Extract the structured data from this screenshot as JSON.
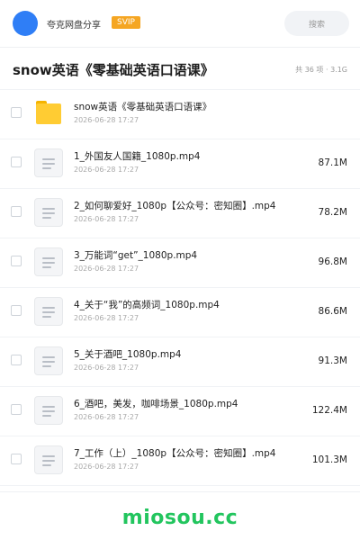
{
  "header": {
    "app_name": "夸克网盘分享",
    "vip_badge": "SVIP",
    "search_placeholder": "搜索"
  },
  "folder": {
    "title": "snow英语《零基础英语口语课》",
    "meta": "共 36 项 · 3.1G"
  },
  "items": [
    {
      "type": "folder",
      "name": "snow英语《零基础英语口语课》",
      "date": "2026-06-28 17:27",
      "size": ""
    },
    {
      "type": "file",
      "name": "1_外国友人国籍_1080p.mp4",
      "date": "2026-06-28 17:27",
      "size": "87.1M"
    },
    {
      "type": "file",
      "name": "2_如何聊爱好_1080p【公众号：密知圈】.mp4",
      "date": "2026-06-28 17:27",
      "size": "78.2M"
    },
    {
      "type": "file",
      "name": "3_万能词“get”_1080p.mp4",
      "date": "2026-06-28 17:27",
      "size": "96.8M"
    },
    {
      "type": "file",
      "name": "4_关于“我”的高频词_1080p.mp4",
      "date": "2026-06-28 17:27",
      "size": "86.6M"
    },
    {
      "type": "file",
      "name": "5_关于酒吧_1080p.mp4",
      "date": "2026-06-28 17:27",
      "size": "91.3M"
    },
    {
      "type": "file",
      "name": "6_酒吧，美发，咖啡场景_1080p.mp4",
      "date": "2026-06-28 17:27",
      "size": "122.4M"
    },
    {
      "type": "file",
      "name": "7_工作（上）_1080p【公众号：密知圈】.mp4",
      "date": "2026-06-28 17:27",
      "size": "101.3M"
    }
  ],
  "watermark": "miosou.cc",
  "colors": {
    "avatar": "#2f7ef6",
    "vip": "#f5a623",
    "folder": "#ffcc33",
    "watermark": "#22c55e"
  }
}
